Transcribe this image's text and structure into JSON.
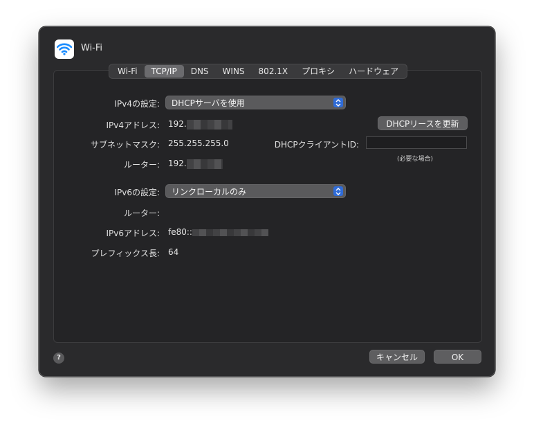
{
  "window": {
    "title": "Wi-Fi",
    "icon": "wifi-icon"
  },
  "tabs": [
    {
      "label": "Wi-Fi",
      "active": false
    },
    {
      "label": "TCP/IP",
      "active": true
    },
    {
      "label": "DNS",
      "active": false
    },
    {
      "label": "WINS",
      "active": false
    },
    {
      "label": "802.1X",
      "active": false
    },
    {
      "label": "プロキシ",
      "active": false
    },
    {
      "label": "ハードウェア",
      "active": false
    }
  ],
  "ipv4": {
    "config_label": "IPv4の設定:",
    "config_value": "DHCPサーバを使用",
    "address_label": "IPv4アドレス:",
    "address_value": "192.",
    "subnet_label": "サブネットマスク:",
    "subnet_value": "255.255.255.0",
    "router_label": "ルーター:",
    "router_value": "192.",
    "renew_button": "DHCPリースを更新",
    "client_id_label": "DHCPクライアントID:",
    "client_id_value": "",
    "client_id_hint": "(必要な場合)"
  },
  "ipv6": {
    "config_label": "IPv6の設定:",
    "config_value": "リンクローカルのみ",
    "router_label": "ルーター:",
    "address_label": "IPv6アドレス:",
    "address_value": "fe80::",
    "prefix_label": "プレフィックス長:",
    "prefix_value": "64"
  },
  "footer": {
    "help": "?",
    "cancel_button": "キャンセル",
    "ok_button": "OK"
  },
  "colors": {
    "window_bg": "#2a2a2c",
    "accent": "#2f6cd8",
    "wifi_blue": "#1a8cff"
  }
}
